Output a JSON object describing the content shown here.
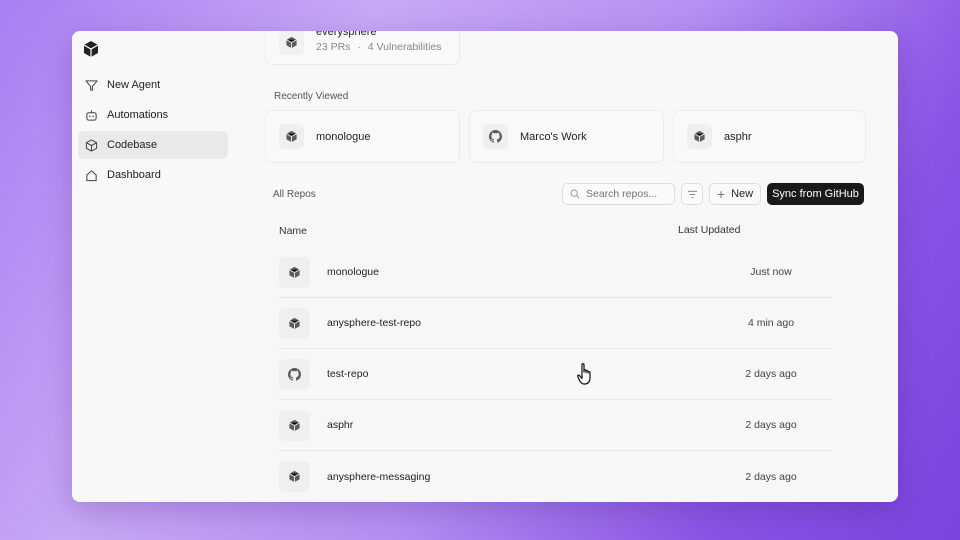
{
  "sidebar": {
    "items": [
      {
        "label": "New Agent",
        "icon": "agent-icon"
      },
      {
        "label": "Automations",
        "icon": "robot-icon"
      },
      {
        "label": "Codebase",
        "icon": "cube-icon",
        "active": true
      },
      {
        "label": "Dashboard",
        "icon": "home-icon"
      }
    ]
  },
  "top_card": {
    "title": "everysphere",
    "prs": "23 PRs",
    "separator": "·",
    "vulns": "4 Vulnerabilities"
  },
  "recently_viewed": {
    "label": "Recently Viewed",
    "items": [
      {
        "name": "monologue",
        "icon": "cube-icon"
      },
      {
        "name": "Marco's Work",
        "icon": "github-icon"
      },
      {
        "name": "asphr",
        "icon": "cube-icon"
      }
    ]
  },
  "repos": {
    "label": "All Repos",
    "search_placeholder": "Search repos...",
    "new_label": "New",
    "sync_label": "Sync from GitHub",
    "columns": {
      "name": "Name",
      "updated": "Last Updated"
    },
    "rows": [
      {
        "name": "monologue",
        "updated": "Just now",
        "icon": "cube-icon"
      },
      {
        "name": "anysphere-test-repo",
        "updated": "4 min ago",
        "icon": "cube-icon"
      },
      {
        "name": "test-repo",
        "updated": "2 days ago",
        "icon": "github-icon"
      },
      {
        "name": "asphr",
        "updated": "2 days ago",
        "icon": "cube-icon"
      },
      {
        "name": "anysphere-messaging",
        "updated": "2 days ago",
        "icon": "cube-icon"
      }
    ]
  },
  "colors": {
    "accent_dark": "#1a1a1a",
    "background_purple": "#9b6bf0"
  }
}
